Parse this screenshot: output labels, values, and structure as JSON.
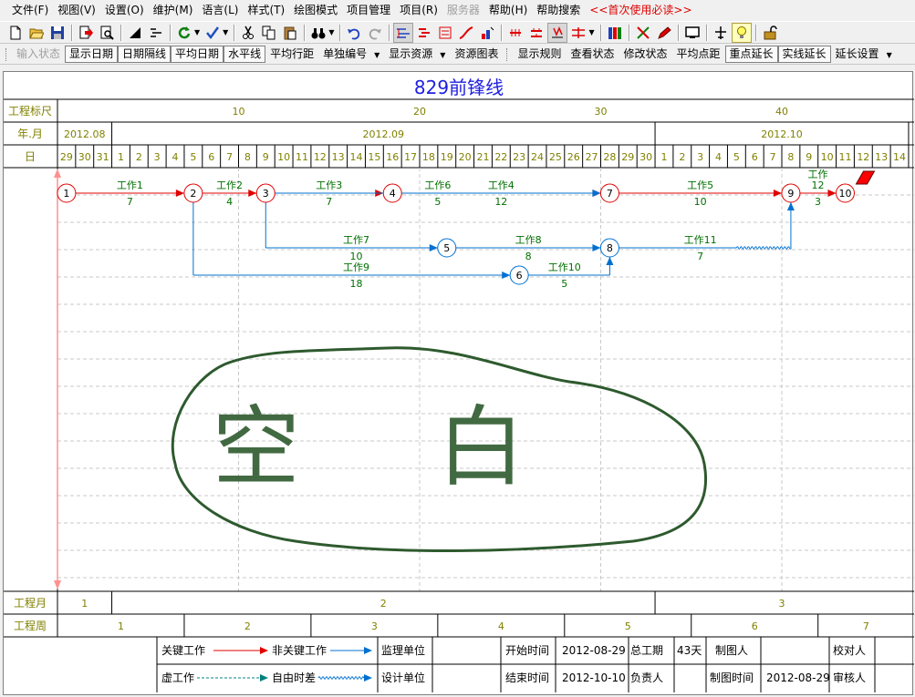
{
  "menubar": {
    "items": [
      {
        "label": "文件(F)"
      },
      {
        "label": "视图(V)"
      },
      {
        "label": "设置(O)"
      },
      {
        "label": "维护(M)"
      },
      {
        "label": "语言(L)"
      },
      {
        "label": "样式(T)"
      },
      {
        "label": "绘图模式"
      },
      {
        "label": "项目管理"
      },
      {
        "label": "项目(R)"
      },
      {
        "label": "服务器",
        "disabled": true
      },
      {
        "label": "帮助(H)"
      },
      {
        "label": "帮助搜索"
      },
      {
        "label": "<<首次使用必读>>",
        "red": true
      }
    ]
  },
  "toolbar2": {
    "items": [
      {
        "label": "输入状态",
        "disabled": true
      },
      {
        "label": "显示日期",
        "pressed": true
      },
      {
        "label": "日期隔线",
        "pressed": true
      },
      {
        "label": "平均日期",
        "pressed": true
      },
      {
        "label": "水平线",
        "pressed": true
      },
      {
        "label": "平均行距"
      },
      {
        "label": "单独编号",
        "dropdown": true
      },
      {
        "label": "显示资源",
        "dropdown": true
      },
      {
        "label": "资源图表"
      },
      {
        "sep": true
      },
      {
        "label": "显示规则"
      },
      {
        "label": "查看状态"
      },
      {
        "label": "修改状态"
      },
      {
        "label": "平均点距"
      },
      {
        "label": "重点延长",
        "pressed": true
      },
      {
        "label": "实线延长",
        "pressed": true
      },
      {
        "label": "延长设置",
        "dropdown": true
      }
    ]
  },
  "chart": {
    "title": "829前锋线",
    "row_labels": {
      "scale": "工程标尺",
      "year_month": "年.月",
      "day": "日",
      "project_month": "工程月",
      "project_week": "工程周"
    },
    "scale_ticks": [
      10,
      20,
      30,
      40
    ],
    "months": [
      "2012.08",
      "2012.09",
      "2012.10"
    ],
    "days": [
      29,
      30,
      31,
      1,
      2,
      3,
      4,
      5,
      6,
      7,
      8,
      9,
      10,
      11,
      12,
      13,
      14,
      15,
      16,
      17,
      18,
      19,
      20,
      21,
      22,
      23,
      24,
      25,
      26,
      27,
      28,
      29,
      30,
      1,
      2,
      3,
      4,
      5,
      6,
      7,
      8,
      9,
      10,
      11,
      12,
      13,
      14
    ],
    "project_months": [
      "1",
      "2",
      "3"
    ],
    "project_weeks": [
      "1",
      "2",
      "3",
      "4",
      "5",
      "6",
      "7"
    ],
    "nodes": [
      {
        "id": "1",
        "day": 0,
        "row": 0,
        "critical": true
      },
      {
        "id": "2",
        "day": 7,
        "row": 0,
        "critical": true
      },
      {
        "id": "3",
        "day": 11,
        "row": 0,
        "critical": true
      },
      {
        "id": "4",
        "day": 18,
        "row": 0,
        "critical": true
      },
      {
        "id": "7",
        "day": 30,
        "row": 0,
        "critical": true
      },
      {
        "id": "9",
        "day": 40,
        "row": 0,
        "critical": true
      },
      {
        "id": "10",
        "day": 43,
        "row": 0,
        "critical": true
      },
      {
        "id": "5",
        "day": 21,
        "row": 2,
        "critical": false
      },
      {
        "id": "8",
        "day": 30,
        "row": 2,
        "critical": false
      },
      {
        "id": "6",
        "day": 25,
        "row": 3,
        "critical": false
      }
    ],
    "activities": [
      {
        "name": "工作1",
        "duration": "7",
        "from": "1",
        "to": "2",
        "critical": true
      },
      {
        "name": "工作2",
        "duration": "4",
        "from": "2",
        "to": "3",
        "critical": true
      },
      {
        "name": "工作3",
        "duration": "7",
        "from": "3",
        "to": "4",
        "critical": true
      },
      {
        "name": "工作4",
        "duration": "12",
        "from": "4",
        "to": "7",
        "critical": true
      },
      {
        "name": "工作5",
        "duration": "10",
        "from": "7",
        "to": "9",
        "critical": true
      },
      {
        "name": "工作",
        "duration": "3",
        "extra": "12",
        "from": "9",
        "to": "10",
        "critical": true
      },
      {
        "name": "工作6",
        "duration": "5",
        "from": "3",
        "to": "7",
        "critical": false
      },
      {
        "name": "工作7",
        "duration": "10",
        "from": "3",
        "to": "5",
        "critical": false
      },
      {
        "name": "工作8",
        "duration": "8",
        "from": "5",
        "to": "8",
        "critical": false
      },
      {
        "name": "工作11",
        "duration": "7",
        "from": "8",
        "to": "9",
        "critical": false
      },
      {
        "name": "工作9",
        "duration": "18",
        "from": "2",
        "to": "6",
        "critical": false
      },
      {
        "name": "工作10",
        "duration": "5",
        "from": "6",
        "to": "8",
        "critical": false
      }
    ],
    "handwriting": "空 白"
  },
  "legend": {
    "critical_work": "关键工作",
    "noncritical_work": "非关键工作",
    "dummy_work": "虚工作",
    "free_float": "自由时差",
    "supervisor": "监理单位",
    "designer": "设计单位",
    "start_label": "开始时间",
    "start_value": "2012-08-29",
    "end_label": "结束时间",
    "end_value": "2012-10-10",
    "total_label": "总工期",
    "total_value": "43天",
    "owner_label": "负责人",
    "drawer_label": "制图人",
    "drawtime_label": "制图时间",
    "drawtime_value": "2012-08-29",
    "checker_label": "校对人",
    "reviewer_label": "审核人"
  },
  "colors": {
    "critical": "#e00000",
    "noncritical": "#0070d0",
    "label": "#007000",
    "title": "#2020e0",
    "header_text": "#808000"
  }
}
